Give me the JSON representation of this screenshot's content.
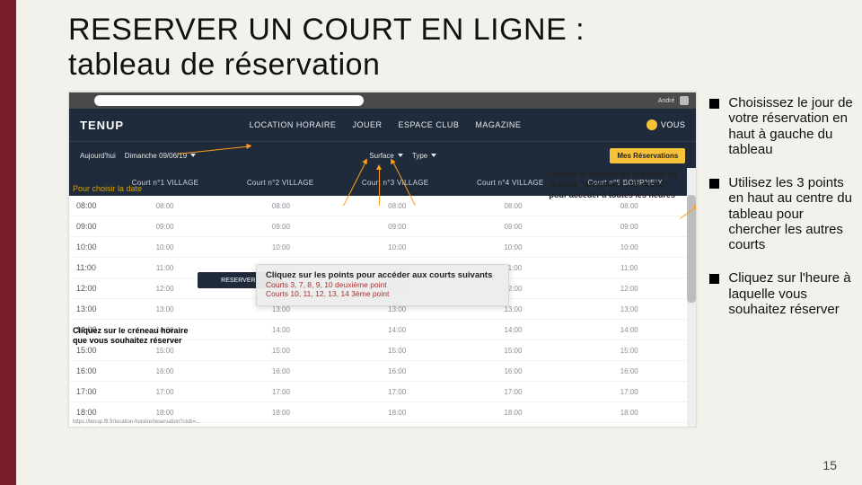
{
  "slide": {
    "title_line1": "RESERVER UN COURT EN LIGNE :",
    "title_line2": "tableau de réservation",
    "page_number": "15"
  },
  "bullets": [
    "Choisissez le jour de votre réservation en haut à gauche du tableau",
    "Utilisez les 3 points en haut au centre du tableau pour chercher les autres courts",
    "Cliquez sur l'heure à laquelle vous souhaitez réserver"
  ],
  "screenshot": {
    "browser_account": "André",
    "logo": "TENUP",
    "nav": [
      "LOCATION HORAIRE",
      "JOUER",
      "ESPACE CLUB",
      "MAGAZINE"
    ],
    "nav_user": "VOUS",
    "filters": {
      "tomorrow": "Aujourd'hui",
      "date": "Dimanche 09/06/19",
      "surface": "Surface",
      "type": "Type"
    },
    "reserve_btn": "Mes Réservations",
    "courts": [
      "Court n°1 VILLAGE",
      "Court n°2 VILLAGE",
      "Court n°3 VILLAGE",
      "Court n°4 VILLAGE",
      "Court n°5 BOURNEIX"
    ],
    "hours": [
      "08:00",
      "09:00",
      "10:00",
      "11:00",
      "12:00",
      "13:00",
      "14:00",
      "15:00",
      "16:00",
      "17:00",
      "18:00"
    ],
    "tip_title": "Cliquez sur les points pour accéder aux courts suivants",
    "tip_line1": "Courts 3, 7, 8, 9, 10 deuxième point",
    "tip_line2": "Courts 10, 11, 12, 13, 14 3ème point",
    "highlight_cell": "RESERVER  ›",
    "annot_date": "Pour choisir la date",
    "annot_left_click": "Cliquez sur le créneau horaire que vous souhaitez réserver",
    "annot_scroll": "Utilisez la roulette de la souris ou la barre \"ascenseur\" de droite pour accéder à toutes les heures",
    "url_hint": "https://tenup.fft.fr/location-horaire/reservation?club=..."
  }
}
